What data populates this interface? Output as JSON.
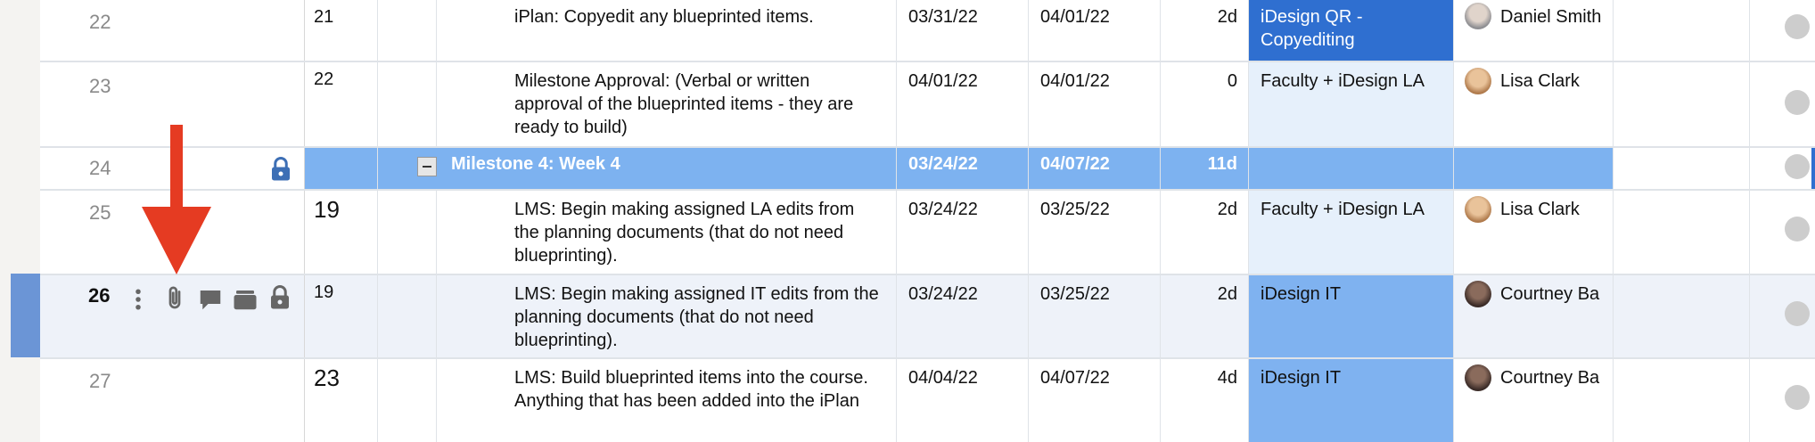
{
  "rows": [
    {
      "rownum": "22",
      "id": "21",
      "task": "iPlan: Copyedit any blueprinted items.",
      "start": "03/31/22",
      "end": "04/01/22",
      "duration": "2d",
      "resource": "iDesign QR - Copyediting",
      "assignee": "Daniel Smith"
    },
    {
      "rownum": "23",
      "id": "22",
      "task": "Milestone Approval: (Verbal or written approval of the blueprinted items - they are ready to build)",
      "start": "04/01/22",
      "end": "04/01/22",
      "duration": "0",
      "resource": "Faculty + iDesign LA",
      "assignee": "Lisa Clark"
    },
    {
      "rownum": "24",
      "id": "",
      "task": "Milestone 4: Week 4",
      "start": "03/24/22",
      "end": "04/07/22",
      "duration": "11d",
      "resource": "",
      "assignee": ""
    },
    {
      "rownum": "25",
      "id": "19",
      "task": "LMS: Begin making assigned LA edits from the planning documents (that do not need blueprinting).",
      "start": "03/24/22",
      "end": "03/25/22",
      "duration": "2d",
      "resource": "Faculty + iDesign LA",
      "assignee": "Lisa Clark"
    },
    {
      "rownum": "26",
      "id": "19",
      "task": "LMS: Begin making assigned IT edits from the planning documents (that do not need blueprinting).",
      "start": "03/24/22",
      "end": "03/25/22",
      "duration": "2d",
      "resource": "iDesign IT",
      "assignee": "Courtney Ba"
    },
    {
      "rownum": "27",
      "id": "23",
      "task": "LMS: Build blueprinted items into the course. Anything that has been added into the iPlan",
      "start": "04/04/22",
      "end": "04/07/22",
      "duration": "4d",
      "resource": "iDesign IT",
      "assignee": "Courtney Ba"
    }
  ],
  "colors": {
    "accent": "#2f6fd0",
    "milestone": "#7db2f0",
    "arrow": "#e53b22"
  },
  "icons": [
    "more-vertical-icon",
    "attachment-icon",
    "comment-icon",
    "proof-icon",
    "lock-icon",
    "collapse-icon"
  ]
}
